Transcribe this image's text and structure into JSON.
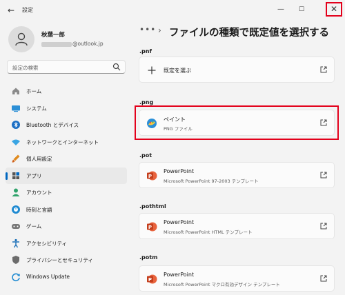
{
  "window": {
    "title": "設定",
    "back_glyph": "←",
    "minimize_glyph": "—",
    "maximize_glyph": "☐",
    "close_glyph": "✕"
  },
  "profile": {
    "name": "秋葉一郎",
    "email_suffix": "@outlook.jp"
  },
  "search": {
    "placeholder": "設定の検索"
  },
  "sidebar": {
    "items": [
      {
        "label": "ホーム",
        "icon": "home-icon"
      },
      {
        "label": "システム",
        "icon": "system-icon"
      },
      {
        "label": "Bluetooth とデバイス",
        "icon": "bluetooth-icon"
      },
      {
        "label": "ネットワークとインターネット",
        "icon": "network-icon"
      },
      {
        "label": "個人用設定",
        "icon": "personalization-icon"
      },
      {
        "label": "アプリ",
        "icon": "apps-icon",
        "active": true
      },
      {
        "label": "アカウント",
        "icon": "account-icon"
      },
      {
        "label": "時刻と言語",
        "icon": "time-language-icon"
      },
      {
        "label": "ゲーム",
        "icon": "gaming-icon"
      },
      {
        "label": "アクセシビリティ",
        "icon": "accessibility-icon"
      },
      {
        "label": "プライバシーとセキュリティ",
        "icon": "privacy-icon"
      },
      {
        "label": "Windows Update",
        "icon": "windows-update-icon"
      }
    ]
  },
  "header": {
    "dots": "•••",
    "chevron": "›",
    "title": "ファイルの種類で既定値を選択する"
  },
  "sections": [
    {
      "ext": ".pnf",
      "app_title": "既定を選ぶ",
      "app_sub": "",
      "icon": "plus-icon"
    },
    {
      "ext": ".png",
      "app_title": "ペイント",
      "app_sub": "PNG ファイル",
      "icon": "paint-icon"
    },
    {
      "ext": ".pot",
      "app_title": "PowerPoint",
      "app_sub": "Microsoft PowerPoint 97-2003 テンプレート",
      "icon": "powerpoint-icon"
    },
    {
      "ext": ".pothtml",
      "app_title": "PowerPoint",
      "app_sub": "Microsoft PowerPoint HTML テンプレート",
      "icon": "powerpoint-icon"
    },
    {
      "ext": ".potm",
      "app_title": "PowerPoint",
      "app_sub": "Microsoft PowerPoint マクロ有効デザイン テンプレート",
      "icon": "powerpoint-icon"
    }
  ],
  "colors": {
    "accent": "#0067c0",
    "highlight": "#e3001b",
    "powerpoint": "#c43e1c"
  }
}
